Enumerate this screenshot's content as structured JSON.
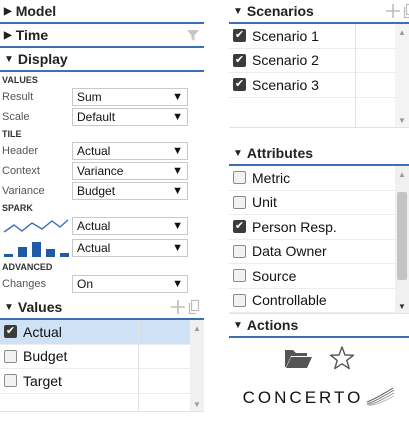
{
  "left": {
    "model": {
      "title": "Model"
    },
    "time": {
      "title": "Time"
    },
    "display": {
      "title": "Display",
      "values_group": "VALUES",
      "result": {
        "label": "Result",
        "value": "Sum"
      },
      "scale": {
        "label": "Scale",
        "value": "Default"
      },
      "tile_group": "TILE",
      "header": {
        "label": "Header",
        "value": "Actual"
      },
      "context": {
        "label": "Context",
        "value": "Variance"
      },
      "variance": {
        "label": "Variance",
        "value": "Budget"
      },
      "spark_group": "SPARK",
      "spark_line": {
        "value": "Actual"
      },
      "spark_bar": {
        "value": "Actual"
      },
      "advanced_group": "ADVANCED",
      "changes": {
        "label": "Changes",
        "value": "On"
      }
    },
    "values": {
      "title": "Values",
      "items": [
        {
          "label": "Actual",
          "checked": true
        },
        {
          "label": "Budget",
          "checked": false
        },
        {
          "label": "Target",
          "checked": false
        }
      ]
    }
  },
  "right": {
    "scenarios": {
      "title": "Scenarios",
      "items": [
        {
          "label": "Scenario 1",
          "checked": true
        },
        {
          "label": "Scenario 2",
          "checked": true
        },
        {
          "label": "Scenario 3",
          "checked": true
        }
      ]
    },
    "attributes": {
      "title": "Attributes",
      "items": [
        {
          "label": "Metric",
          "checked": false
        },
        {
          "label": "Unit",
          "checked": false
        },
        {
          "label": "Person Resp.",
          "checked": true
        },
        {
          "label": "Data Owner",
          "checked": false
        },
        {
          "label": "Source",
          "checked": false
        },
        {
          "label": "Controllable",
          "checked": false
        }
      ]
    },
    "actions": {
      "title": "Actions"
    },
    "logo_text": "CONCERTO"
  },
  "icons": {
    "caret_right": "▶",
    "caret_down": "▼",
    "select_arrow": "▼",
    "check": "✔",
    "scroll_up": "▲",
    "scroll_down": "▼"
  },
  "colors": {
    "accent": "#3b6fb6",
    "selected_row": "#cfe1f4"
  }
}
